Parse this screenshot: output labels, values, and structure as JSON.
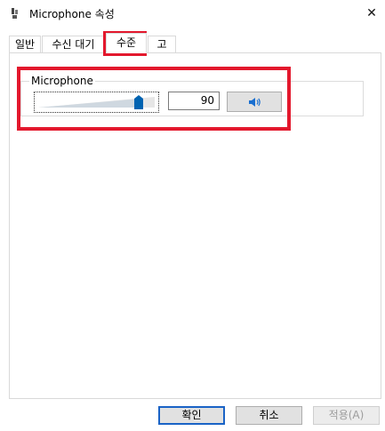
{
  "window": {
    "title": "Microphone 속성",
    "close_glyph": "✕"
  },
  "tabs": [
    {
      "label": "일반"
    },
    {
      "label": "수신 대기"
    },
    {
      "label": "수준",
      "active": true
    },
    {
      "label": "고급"
    }
  ],
  "level": {
    "group_label": "Microphone",
    "slider_value": 90,
    "value_text": "90",
    "mute_button_icon": "speaker-icon"
  },
  "buttons": {
    "ok": "확인",
    "cancel": "취소",
    "apply": "적용(A)"
  },
  "colors": {
    "highlight_box": "#e3182d",
    "slider_thumb": "#0063b1",
    "default_button_border": "#1a63c6"
  }
}
